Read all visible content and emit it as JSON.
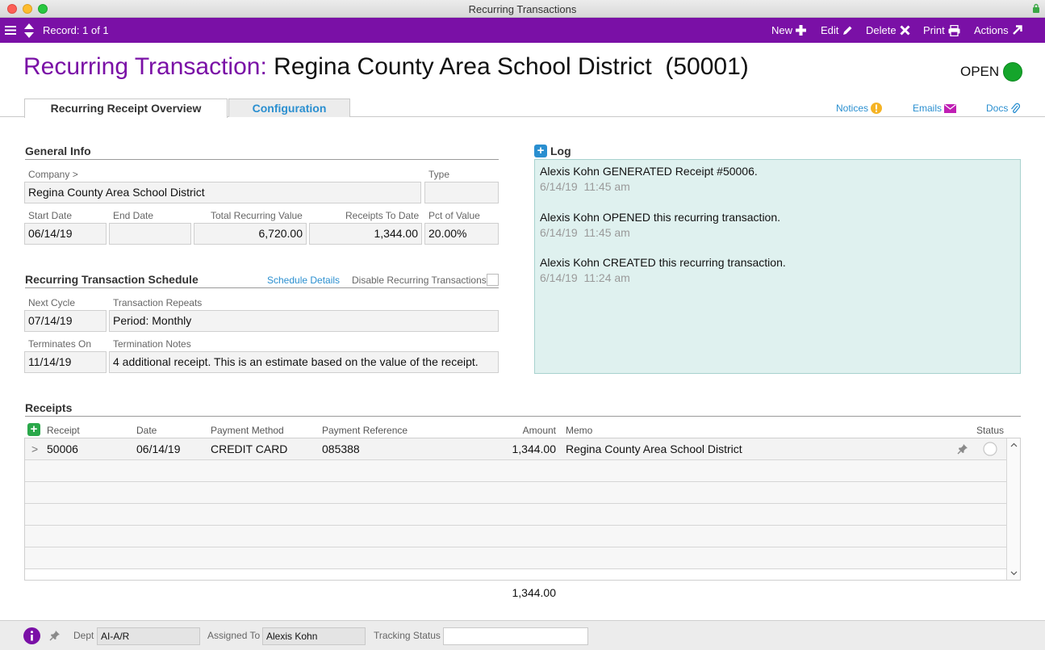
{
  "window": {
    "title": "Recurring Transactions"
  },
  "toolbar": {
    "record": "Record: 1 of 1",
    "new": "New",
    "edit": "Edit",
    "delete": "Delete",
    "print": "Print",
    "actions": "Actions"
  },
  "header": {
    "prefix": "Recurring Transaction:",
    "name": "Regina County Area School District  (50001)",
    "status": "OPEN",
    "status_color": "#15a52b"
  },
  "tabs": [
    {
      "label": "Recurring Receipt Overview",
      "active": true
    },
    {
      "label": "Configuration",
      "active": false
    }
  ],
  "links": {
    "notices": "Notices",
    "emails": "Emails",
    "docs": "Docs"
  },
  "general_info": {
    "title": "General Info",
    "company_label": "Company >",
    "company": "Regina County Area School District",
    "type_label": "Type",
    "type": "",
    "start_date_label": "Start Date",
    "start_date": "06/14/19",
    "end_date_label": "End Date",
    "end_date": "",
    "total_value_label": "Total Recurring Value",
    "total_value": "6,720.00",
    "receipts_to_date_label": "Receipts To Date",
    "receipts_to_date": "1,344.00",
    "pct_label": "Pct of Value",
    "pct": "20.00%"
  },
  "schedule": {
    "title": "Recurring Transaction Schedule",
    "details_link": "Schedule Details",
    "disable_label": "Disable Recurring Transactions",
    "next_cycle_label": "Next Cycle",
    "next_cycle": "07/14/19",
    "repeats_label": "Transaction Repeats",
    "repeats": "Period: Monthly",
    "terminates_label": "Terminates On",
    "terminates": "11/14/19",
    "notes_label": "Termination Notes",
    "notes": "4 additional receipt. This is an estimate based on the value of the receipt."
  },
  "log": {
    "title": "Log",
    "entries": [
      {
        "text": "Alexis Kohn GENERATED Receipt #50006.",
        "time": "6/14/19  11:45 am"
      },
      {
        "text": "Alexis Kohn OPENED this recurring transaction.",
        "time": "6/14/19  11:45 am"
      },
      {
        "text": "Alexis Kohn CREATED this recurring transaction.",
        "time": "6/14/19  11:24 am"
      }
    ]
  },
  "receipts": {
    "title": "Receipts",
    "columns": [
      "Receipt",
      "Date",
      "Payment Method",
      "Payment Reference",
      "Amount",
      "Memo",
      "Status"
    ],
    "rows": [
      {
        "expander": ">",
        "receipt": "50006",
        "date": "06/14/19",
        "method": "CREDIT CARD",
        "reference": "085388",
        "amount": "1,344.00",
        "memo": "Regina County Area School District"
      }
    ],
    "total": "1,344.00"
  },
  "footer": {
    "dept_label": "Dept",
    "dept": "AI-A/R",
    "assigned_label": "Assigned To",
    "assigned": "Alexis Kohn",
    "tracking_label": "Tracking Status",
    "tracking": ""
  }
}
